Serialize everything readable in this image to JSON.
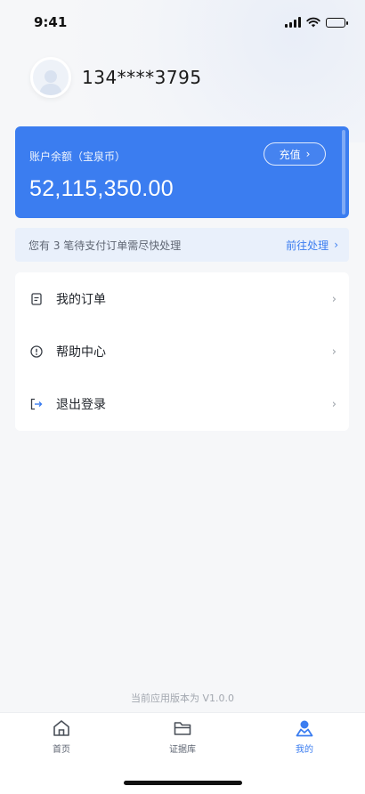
{
  "status_bar": {
    "time": "9:41"
  },
  "profile": {
    "phone": "134****3795",
    "avatar_icon": "user-avatar-icon"
  },
  "balance": {
    "label": "账户余额（宝泉币）",
    "amount": "52,115,350.00",
    "recharge_label": "充值"
  },
  "notice": {
    "text": "您有 3 笔待支付订单需尽快处理",
    "action_label": "前往处理"
  },
  "menu": {
    "items": [
      {
        "label": "我的订单",
        "icon": "document-icon"
      },
      {
        "label": "帮助中心",
        "icon": "info-icon"
      },
      {
        "label": "退出登录",
        "icon": "logout-icon"
      }
    ]
  },
  "footer": {
    "version": "当前应用版本为 V1.0.0"
  },
  "tabbar": {
    "tabs": [
      {
        "label": "首页",
        "icon": "home-icon",
        "active": false
      },
      {
        "label": "证据库",
        "icon": "folder-icon",
        "active": false
      },
      {
        "label": "我的",
        "icon": "profile-icon",
        "active": true
      }
    ]
  },
  "colors": {
    "accent": "#3b7df0",
    "notice_bg": "#e9f0fb",
    "page_bg": "#f6f7f9"
  }
}
